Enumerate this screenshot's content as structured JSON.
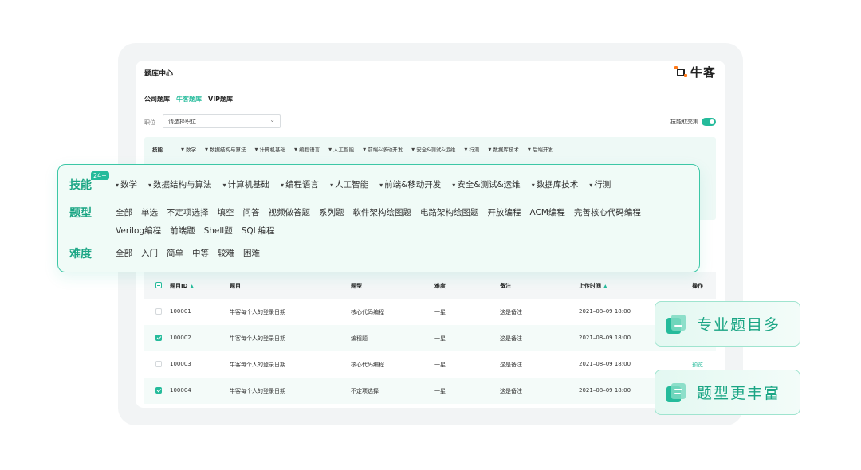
{
  "colors": {
    "accent": "#25bb9b",
    "accent_dark": "#1aa584",
    "brand_dot": "#ff7a1a"
  },
  "panel": {
    "title": "题库中心",
    "brand_name": "牛客",
    "bank_tabs": [
      "公司题库",
      "牛客题库",
      "VIP题库"
    ],
    "active_bank_tab": "牛客题库",
    "position_label": "职位",
    "position_placeholder": "请选择职位",
    "toggle_label": "技能取交集",
    "toggle_on": true,
    "bg_filter": {
      "label": "技能",
      "items": [
        "数学",
        "数据结构与算法",
        "计算机基础",
        "编程语言",
        "人工智能",
        "前端&移动开发",
        "安全&测试&运维",
        "行测",
        "数据库技术",
        "后端开发"
      ]
    }
  },
  "table": {
    "columns": [
      "题目ID",
      "题目",
      "题型",
      "难度",
      "备注",
      "上传时间",
      "操作"
    ],
    "rows": [
      {
        "id": "100001",
        "title": "牛客每个人的登录日期",
        "type": "核心代码编程",
        "difficulty": "一星",
        "note": "这是备注",
        "time": "2021–08–09 18:00",
        "action": "",
        "checked": false
      },
      {
        "id": "100002",
        "title": "牛客每个人的登录日期",
        "type": "编程题",
        "difficulty": "一星",
        "note": "这是备注",
        "time": "2021–08–09 18:00",
        "action": "",
        "checked": true
      },
      {
        "id": "100003",
        "title": "牛客每个人的登录日期",
        "type": "核心代码编程",
        "difficulty": "一星",
        "note": "这是备注",
        "time": "2021–08–09 18:00",
        "action": "预览",
        "checked": false
      },
      {
        "id": "100004",
        "title": "牛客每个人的登录日期",
        "type": "不定项选择",
        "difficulty": "一星",
        "note": "这是备注",
        "time": "2021–08–09 18:00",
        "action": "",
        "checked": true
      }
    ]
  },
  "overlay": {
    "skills": {
      "label": "技能",
      "badge": "24+",
      "items": [
        "数学",
        "数据结构与算法",
        "计算机基础",
        "编程语言",
        "人工智能",
        "前端&移动开发",
        "安全&测试&运维",
        "数据库技术",
        "行测"
      ]
    },
    "types": {
      "label": "题型",
      "items": [
        "全部",
        "单选",
        "不定项选择",
        "填空",
        "问答",
        "视频做答题",
        "系列题",
        "软件架构绘图题",
        "电路架构绘图题",
        "开放编程",
        "ACM编程",
        "完善核心代码编程",
        "Verilog编程",
        "前端题",
        "Shell题",
        "SQL编程"
      ]
    },
    "difficulty": {
      "label": "难度",
      "items": [
        "全部",
        "入门",
        "简单",
        "中等",
        "较难",
        "困难"
      ]
    }
  },
  "features": [
    {
      "text": "专业题目多",
      "icon": "edit-doc-icon"
    },
    {
      "text": "题型更丰富",
      "icon": "doc-stack-icon"
    }
  ]
}
